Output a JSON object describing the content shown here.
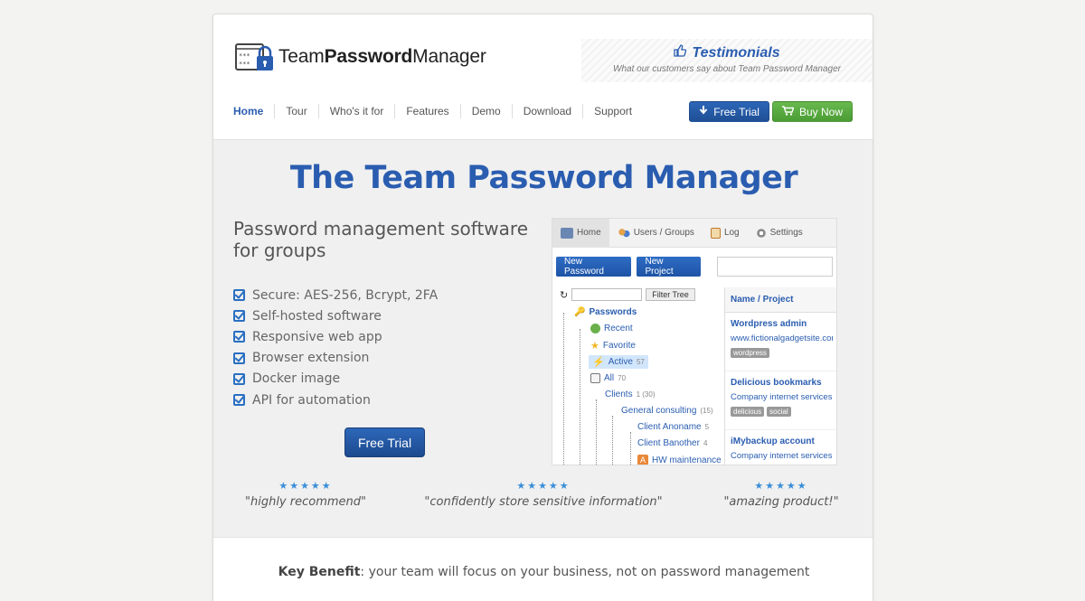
{
  "header": {
    "logo_text_pre": "Team",
    "logo_text_bold": "Password",
    "logo_text_post": "Manager",
    "testimonials_title": "Testimonials",
    "testimonials_sub": "What our customers say about Team Password Manager"
  },
  "nav": [
    "Home",
    "Tour",
    "Who's it for",
    "Features",
    "Demo",
    "Download",
    "Support"
  ],
  "header_buttons": {
    "free_trial": "Free Trial",
    "buy_now": "Buy Now"
  },
  "hero": {
    "title": "The Team Password Manager",
    "subtitle_line1": "Password management software",
    "subtitle_line2": "for groups",
    "features": [
      "Secure: AES-256, Bcrypt, 2FA",
      "Self-hosted software",
      "Responsive web app",
      "Browser extension",
      "Docker image",
      "API for automation"
    ],
    "cta": "Free Trial"
  },
  "reviews": [
    {
      "stars": "★★★★★",
      "quote": "\"highly recommend\""
    },
    {
      "stars": "★★★★★",
      "quote": "\"confidently store sensitive information\""
    },
    {
      "stars": "★★★★★",
      "quote": "\"amazing product!\""
    }
  ],
  "app": {
    "tabs": [
      "Home",
      "Users / Groups",
      "Log",
      "Settings"
    ],
    "new_password": "New Password",
    "new_project": "New Project",
    "filter_btn": "Filter Tree",
    "tree": {
      "passwords": "Passwords",
      "recent": "Recent",
      "favorite": "Favorite",
      "active": "Active",
      "active_count": "57",
      "all": "All",
      "all_count": "70",
      "clients": "Clients",
      "clients_count": "1 (30)",
      "general": "General consulting",
      "general_count": "(15)",
      "anoname": "Client Anoname",
      "anoname_count": "5",
      "banother": "Client Banother",
      "banother_count": "4",
      "hw": "HW maintenance"
    },
    "list_header": "Name / Project",
    "items": [
      {
        "name": "Wordpress admin",
        "url": "www.fictionalgadgetsite.com",
        "tags": [
          "wordpress"
        ]
      },
      {
        "name": "Delicious bookmarks",
        "url": "Company internet services",
        "tags": [
          "delicious",
          "social"
        ]
      },
      {
        "name": "iMybackup account",
        "url": "Company internet services",
        "tags": []
      }
    ]
  },
  "key_benefit": {
    "label": "Key Benefit",
    "text": ": your team will focus on your business, not on password management"
  },
  "colors": {
    "brand_blue": "#2a5db0",
    "buy_green": "#5aab40"
  }
}
